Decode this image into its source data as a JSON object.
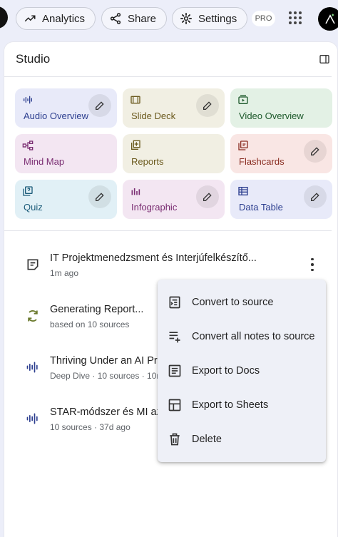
{
  "topbar": {
    "analytics_label": "Analytics",
    "share_label": "Share",
    "settings_label": "Settings",
    "pro_badge": "PRO"
  },
  "studio": {
    "title": "Studio",
    "tiles": [
      {
        "label": "Audio Overview",
        "icon": "audio-waveform-icon",
        "bg": "#e8eaf9",
        "color": "#2c3e8f",
        "edit": true
      },
      {
        "label": "Slide Deck",
        "icon": "slides-icon",
        "bg": "#f1efe3",
        "color": "#6b5a1e",
        "edit": true
      },
      {
        "label": "Video Overview",
        "icon": "video-icon",
        "bg": "#e3f1e5",
        "color": "#1e5a2c",
        "edit": false
      },
      {
        "label": "Mind Map",
        "icon": "mind-map-icon",
        "bg": "#f3e6f2",
        "color": "#7a2d72",
        "edit": false
      },
      {
        "label": "Reports",
        "icon": "reports-icon",
        "bg": "#f1efe3",
        "color": "#6b5a1e",
        "edit": false
      },
      {
        "label": "Flashcards",
        "icon": "flashcards-icon",
        "bg": "#f9e6e4",
        "color": "#8a2e22",
        "edit": true
      },
      {
        "label": "Quiz",
        "icon": "quiz-icon",
        "bg": "#e1f0f6",
        "color": "#1c5c7a",
        "edit": true
      },
      {
        "label": "Infographic",
        "icon": "infographic-icon",
        "bg": "#f3e6f2",
        "color": "#7a2d72",
        "edit": true
      },
      {
        "label": "Data Table",
        "icon": "table-icon",
        "bg": "#e8eaf9",
        "color": "#2c3e8f",
        "edit": true
      }
    ]
  },
  "notes": [
    {
      "title": "IT Projektmenedzsment és Interjúfelkészítő...",
      "subtitle": "1m ago",
      "icon": "note-icon"
    },
    {
      "title": "Generating Report...",
      "subtitle": "based on 10 sources",
      "icon": "sync-icon"
    },
    {
      "title": "Thriving Under an AI Pr",
      "subtitle": "Deep Dive · 10 sources · 10m",
      "icon": "audio-waveform-icon"
    },
    {
      "title": "STAR-módszer és MI az",
      "subtitle": "10 sources · 37d ago",
      "icon": "audio-waveform-icon"
    }
  ],
  "menu": {
    "items": [
      {
        "label": "Convert to source",
        "icon": "convert-source-icon"
      },
      {
        "label": "Convert all notes to source",
        "icon": "convert-all-icon"
      },
      {
        "label": "Export to Docs",
        "icon": "docs-icon"
      },
      {
        "label": "Export to Sheets",
        "icon": "sheets-icon"
      },
      {
        "label": "Delete",
        "icon": "trash-icon"
      }
    ]
  }
}
